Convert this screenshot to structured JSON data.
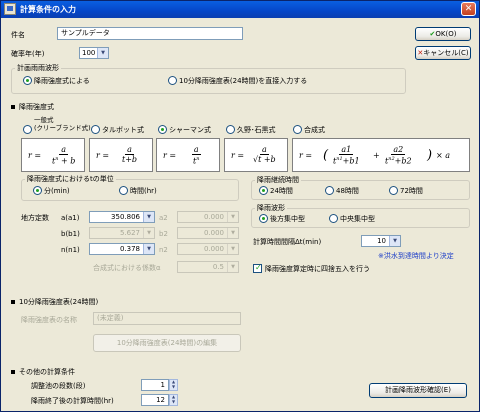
{
  "window": {
    "title": "計算条件の入力"
  },
  "header": {
    "name_label": "件名",
    "name_value": "サンプルデータ",
    "return_period_label": "確率年(年)",
    "return_period_value": "100",
    "ok_label": "OK(O)",
    "cancel_label": "キャンセル(C)"
  },
  "hyetograph": {
    "group_title": "計画雨雨波形",
    "option1": "降雨強度式による",
    "option2": "10分降雨強度表(24時間)を直接入力する"
  },
  "intensity": {
    "section_title": "降雨強度式",
    "types": [
      "一般式\n(クリーブランド式)",
      "タルボット式",
      "シャーマン式",
      "久野･石黒式",
      "合成式"
    ],
    "unit_group_title": "降雨強度式におけるtの単位",
    "unit_min": "分(min)",
    "unit_hr": "時間(hr)",
    "constants_label": "地方定数",
    "a1_label": "a(a1)",
    "a1_value": "350.806",
    "b1_label": "b(b1)",
    "b1_value": "5.627",
    "n1_label": "n(n1)",
    "n1_value": "0.378",
    "a2_label": "a2",
    "a2_value": "0.000",
    "b2_label": "b2",
    "b2_value": "0.000",
    "n2_label": "n2",
    "n2_value": "0.000",
    "alpha_label": "合成式における係数α",
    "alpha_value": "0.5"
  },
  "duration": {
    "group_title": "降雨継続時間",
    "opt24": "24時間",
    "opt48": "48時間",
    "opt72": "72時間"
  },
  "waveform": {
    "group_title": "降雨波形",
    "opt_rear": "後方集中型",
    "opt_center": "中央集中型"
  },
  "interval": {
    "label": "計算時間間隔Δt(min)",
    "value": "10",
    "note": "※洪水到達時間より決定",
    "round_label": "降雨強度算定時に四捨五入を行う"
  },
  "table10": {
    "section_title": "10分降雨強度表(24時間)",
    "name_label": "降雨強度表の名称",
    "name_value": "(未定義)",
    "edit_button": "10分降雨強度表(24時間)の編集"
  },
  "other": {
    "section_title": "その他の計算条件",
    "ponds_label": "調整池の段数(段)",
    "ponds_value": "1",
    "after_label": "降雨終了後の計算時間(hr)",
    "after_value": "12",
    "confirm_button": "計画降雨波形確認(E)"
  }
}
